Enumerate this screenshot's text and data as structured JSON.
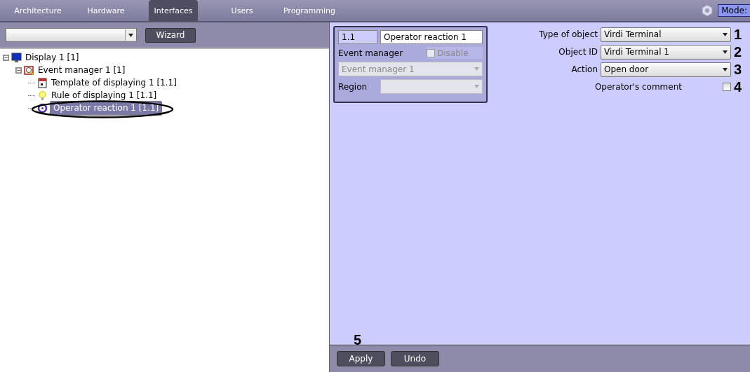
{
  "tabs": [
    {
      "label": "Architecture",
      "selected": false
    },
    {
      "label": "Hardware",
      "selected": false
    },
    {
      "label": "Interfaces",
      "selected": true
    },
    {
      "label": "Users",
      "selected": false
    },
    {
      "label": "Programming",
      "selected": false
    }
  ],
  "mode_button": {
    "label": "Mode:"
  },
  "toolbar": {
    "wizard_button": "Wizard"
  },
  "tree": [
    {
      "label": "Display 1 [1]",
      "kind": "monitor",
      "expanded": true,
      "selected": false,
      "children": [
        {
          "label": "Event manager 1 [1]",
          "kind": "manager",
          "expanded": true,
          "selected": false,
          "children": [
            {
              "label": "Template of displaying 1 [1.1]",
              "kind": "template",
              "selected": false
            },
            {
              "label": "Rule of displaying 1 [1.1]",
              "kind": "bulb",
              "selected": false
            },
            {
              "label": "Operator reaction 1 [1.1]",
              "kind": "target",
              "selected": true,
              "circled": true
            }
          ]
        }
      ]
    }
  ],
  "object_panel": {
    "id": "1.1",
    "name": "Operator reaction 1",
    "parent_label": "Event manager",
    "disable_label": "Disable",
    "disable_checked": false,
    "parent_value": "Event manager 1",
    "region_label": "Region"
  },
  "settings": [
    {
      "kind": "select",
      "label": "Type of object",
      "value": "Virdi Terminal",
      "callout": "1"
    },
    {
      "kind": "select",
      "label": "Object ID",
      "value": "Virdi Terminal 1",
      "callout": "2"
    },
    {
      "kind": "select",
      "label": "Action",
      "value": "Open door",
      "callout": "3"
    },
    {
      "kind": "checkbox",
      "label": "Operator's comment",
      "checked": false,
      "callout": "4"
    }
  ],
  "buttons": [
    {
      "label": "Apply",
      "callout": "5"
    },
    {
      "label": "Undo"
    }
  ]
}
